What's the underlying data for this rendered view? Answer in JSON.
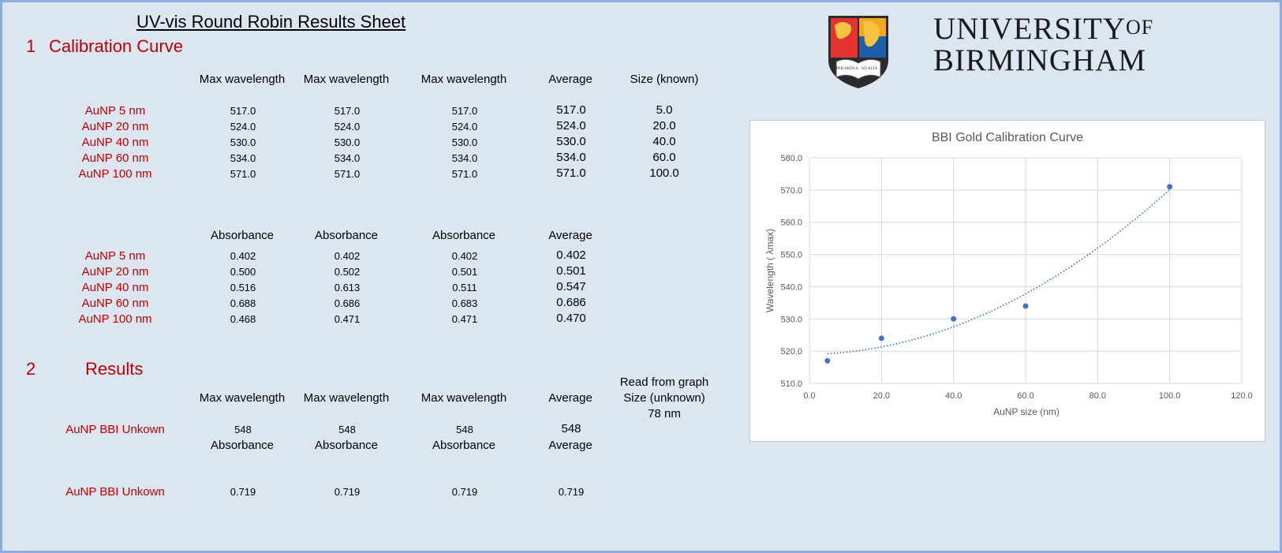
{
  "sheet": {
    "title": "UV-vis Round Robin Results Sheet",
    "section1": {
      "number": "1",
      "title": "Calibration Curve"
    },
    "section2": {
      "number": "2",
      "title": "Results"
    }
  },
  "wavelength_table": {
    "headers": [
      "Max wavelength",
      "Max wavelength",
      "Max wavelength",
      "Average",
      "Size (known)"
    ],
    "rows": [
      {
        "label": "AuNP 5 nm",
        "values": [
          "517.0",
          "517.0",
          "517.0",
          "517.0",
          "5.0"
        ]
      },
      {
        "label": "AuNP 20 nm",
        "values": [
          "524.0",
          "524.0",
          "524.0",
          "524.0",
          "20.0"
        ]
      },
      {
        "label": "AuNP 40 nm",
        "values": [
          "530.0",
          "530.0",
          "530.0",
          "530.0",
          "40.0"
        ]
      },
      {
        "label": "AuNP 60 nm",
        "values": [
          "534.0",
          "534.0",
          "534.0",
          "534.0",
          "60.0"
        ]
      },
      {
        "label": "AuNP 100 nm",
        "values": [
          "571.0",
          "571.0",
          "571.0",
          "571.0",
          "100.0"
        ]
      }
    ]
  },
  "absorbance_table": {
    "headers": [
      "Absorbance",
      "Absorbance",
      "Absorbance",
      "Average"
    ],
    "rows": [
      {
        "label": "AuNP 5 nm",
        "values": [
          "0.402",
          "0.402",
          "0.402",
          "0.402"
        ]
      },
      {
        "label": "AuNP 20 nm",
        "values": [
          "0.500",
          "0.502",
          "0.501",
          "0.501"
        ]
      },
      {
        "label": "AuNP 40 nm",
        "values": [
          "0.516",
          "0.613",
          "0.511",
          "0.547"
        ]
      },
      {
        "label": "AuNP 60 nm",
        "values": [
          "0.688",
          "0.686",
          "0.683",
          "0.686"
        ]
      },
      {
        "label": "AuNP 100 nm",
        "values": [
          "0.468",
          "0.471",
          "0.471",
          "0.470"
        ]
      }
    ]
  },
  "results": {
    "headers": [
      "Max wavelength",
      "Max wavelength",
      "Max wavelength",
      "Average"
    ],
    "read_from_graph": "Read from graph",
    "size_unknown_label": "Size (unknown)",
    "size_unknown_value": "78 nm",
    "wavelength_row": {
      "label": "AuNP BBI Unkown",
      "values": [
        "548",
        "548",
        "548",
        "548"
      ]
    },
    "absorbance_headers": [
      "Absorbance",
      "Absorbance",
      "Absorbance",
      "Average"
    ],
    "absorbance_row": {
      "label": "AuNP BBI Unkown",
      "values": [
        "0.719",
        "0.719",
        "0.719",
        "0.719"
      ]
    }
  },
  "logo": {
    "line1": "UNIVERSITY",
    "line1_suffix": "OF",
    "line2": "BIRMINGHAM",
    "book_left": "PER ARDUA",
    "book_right": "AD ALTA",
    "colors": {
      "red": "#e3342f",
      "blue": "#1f5ea8",
      "gold": "#f5a623",
      "dark": "#2b2b2b"
    }
  },
  "chart_data": {
    "type": "scatter",
    "title": "BBI Gold Calibration Curve",
    "xlabel": "AuNP size (nm)",
    "ylabel": "Wavelength ( λmax)",
    "xlim": [
      0,
      120
    ],
    "ylim": [
      510,
      580
    ],
    "x_ticks": [
      "0.0",
      "20.0",
      "40.0",
      "60.0",
      "80.0",
      "100.0",
      "120.0"
    ],
    "y_ticks": [
      "510.0",
      "520.0",
      "530.0",
      "540.0",
      "550.0",
      "560.0",
      "570.0",
      "580.0"
    ],
    "grid": true,
    "legend": "none",
    "series": [
      {
        "x": [
          5,
          20,
          40,
          60,
          100
        ],
        "y": [
          517,
          524,
          530,
          534,
          571
        ],
        "color": "#4472c4"
      }
    ],
    "trendline": {
      "type": "polynomial",
      "style": "dotted",
      "color": "#2e75b6"
    }
  }
}
